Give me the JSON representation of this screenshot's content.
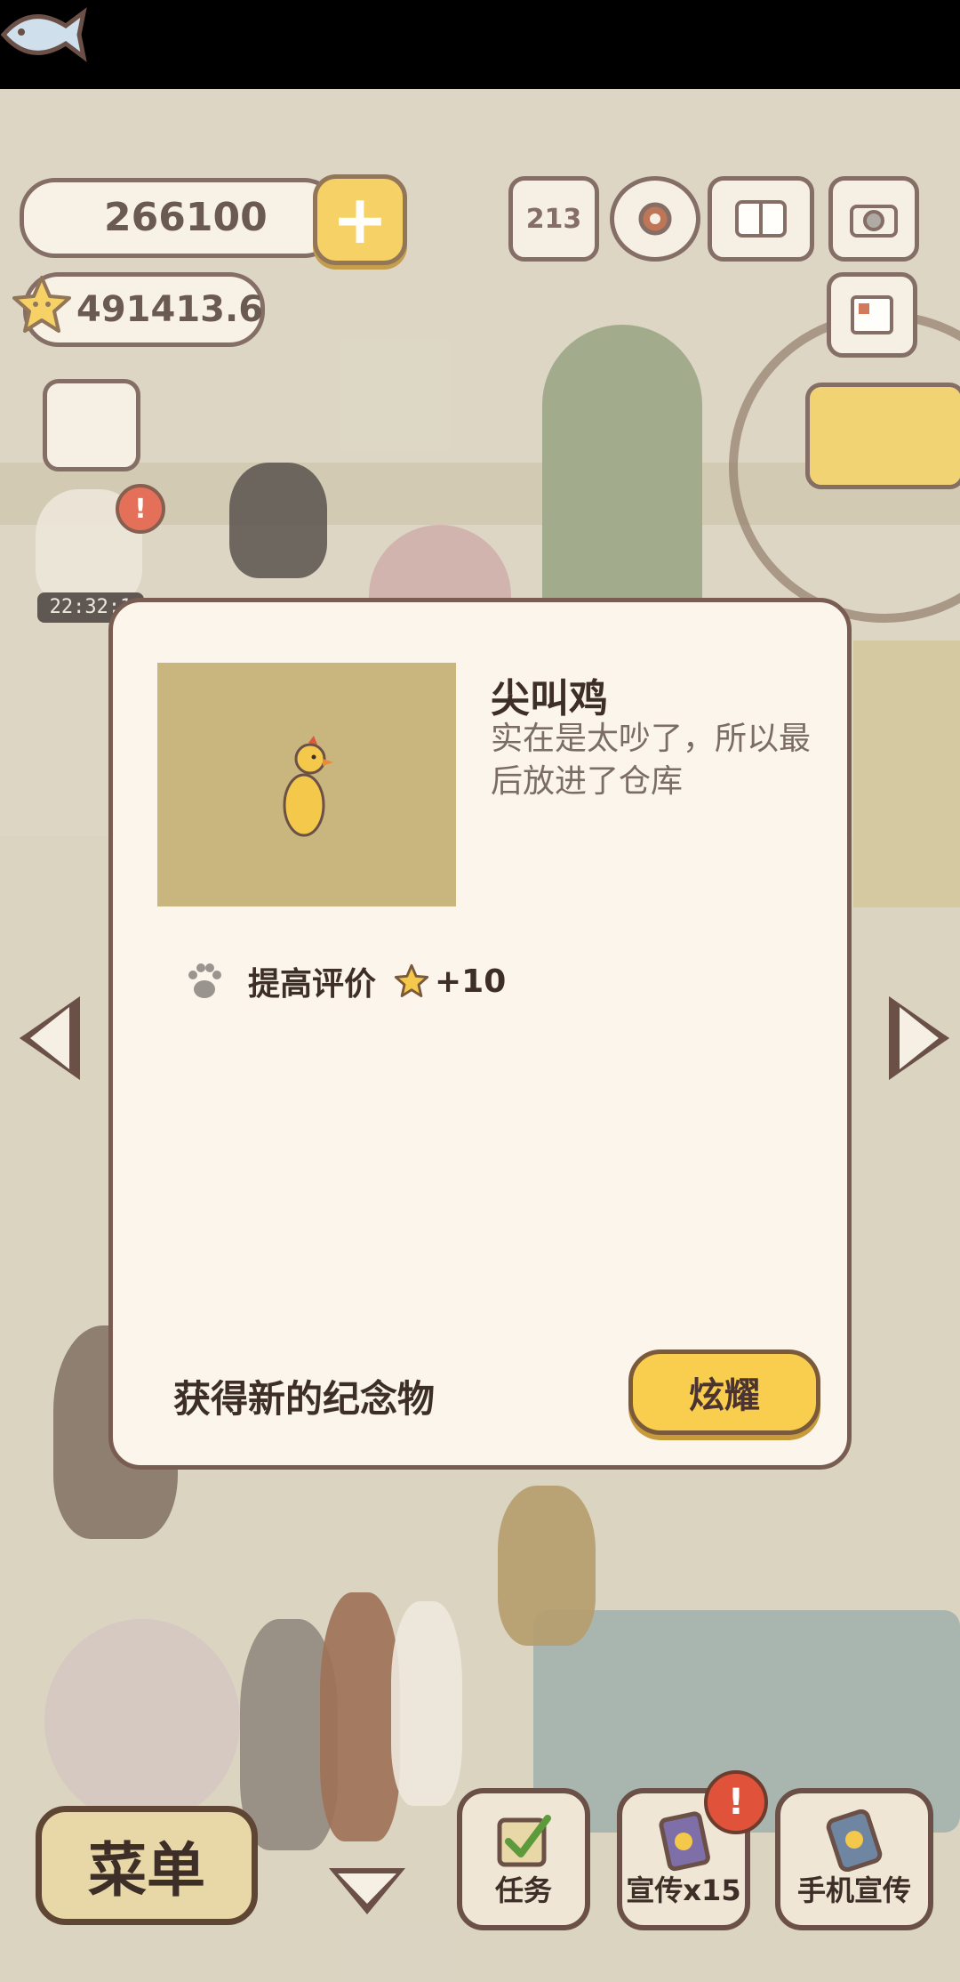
{
  "hud": {
    "fish_count": "266100",
    "star_count": "491413.6",
    "add_label": "+",
    "rank_label": "213",
    "timer": "22:32:1"
  },
  "dialog": {
    "item_name": "尖叫鸡",
    "item_description": "实在是太吵了，所以最后放进了仓库",
    "effect_label": "提高评价",
    "effect_bonus": "+10",
    "footer_text": "获得新的纪念物",
    "show_button": "炫耀"
  },
  "bottom_bar": {
    "menu_label": "菜单",
    "task_label": "任务",
    "promo_label": "宣传x15",
    "phone_promo_label": "手机宣传",
    "alert_mark": "!"
  },
  "colors": {
    "accent_yellow": "#f9ce4f",
    "outline_brown": "#6b5048",
    "dialog_bg": "#fbf5ec",
    "item_image_bg": "#c9b57e"
  }
}
